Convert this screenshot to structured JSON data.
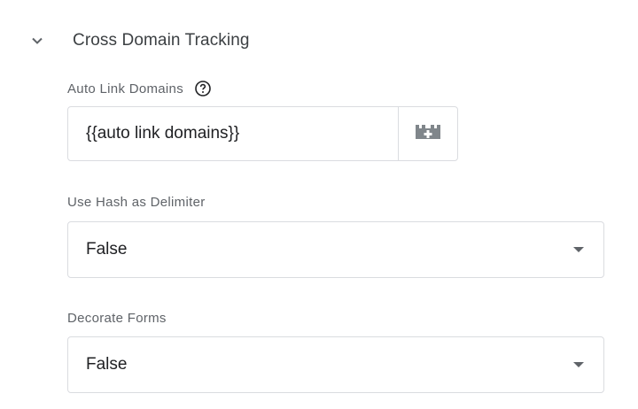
{
  "section": {
    "title": "Cross Domain Tracking",
    "chevron_icon": "chevron-down-icon"
  },
  "auto_link": {
    "label": "Auto Link Domains",
    "help_icon": "help-icon",
    "value": "{{auto link domains}}",
    "variable_icon": "add-variable-icon"
  },
  "use_hash": {
    "label": "Use Hash as Delimiter",
    "selected": "False"
  },
  "decorate_forms": {
    "label": "Decorate Forms",
    "selected": "False"
  },
  "colors": {
    "label": "#5f6368",
    "border": "#dadce0",
    "text": "#202124",
    "icon": "#5f6368",
    "variable_icon": "#80868b"
  }
}
